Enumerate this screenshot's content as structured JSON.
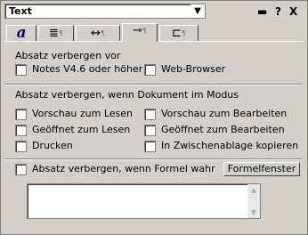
{
  "header": {
    "type_value": "Text",
    "dropdown_arrow": "▼",
    "properties_icon": "▬",
    "help_label": "?",
    "close_label": "X"
  },
  "tabs": [
    {
      "name": "font",
      "glyph": "a"
    },
    {
      "name": "paragraph",
      "glyph": "≣",
      "sub": "¶"
    },
    {
      "name": "spacing",
      "glyph": "↔",
      "sub": "¶"
    },
    {
      "name": "hide",
      "glyph": "⊸",
      "sub": "¶"
    },
    {
      "name": "field",
      "glyph": "⊏",
      "sub": "¶"
    }
  ],
  "section1": {
    "title": "Absatz verbergen vor",
    "notes": "Notes V4.6 oder höher",
    "web": "Web-Browser"
  },
  "section2": {
    "title": "Absatz verbergen, wenn Dokument im Modus",
    "opt_read_preview": "Vorschau zum Lesen",
    "opt_edit_preview": "Vorschau zum Bearbeiten",
    "opt_open_read": "Geöffnet zum Lesen",
    "opt_open_edit": "Geöffnet zum Bearbeiten",
    "opt_print": "Drucken",
    "opt_clipboard": "In Zwischenablage kopieren"
  },
  "formula": {
    "checkbox_label": "Absatz verbergen, wenn Formel wahr",
    "button_label": "Formelfenster",
    "value": "",
    "scroll_up": "▲",
    "scroll_down": "▼"
  },
  "checkbox_states": {
    "notes": false,
    "web": false,
    "read_preview": false,
    "edit_preview": false,
    "open_read": false,
    "open_edit": false,
    "print": false,
    "clipboard": false,
    "formula": false
  }
}
